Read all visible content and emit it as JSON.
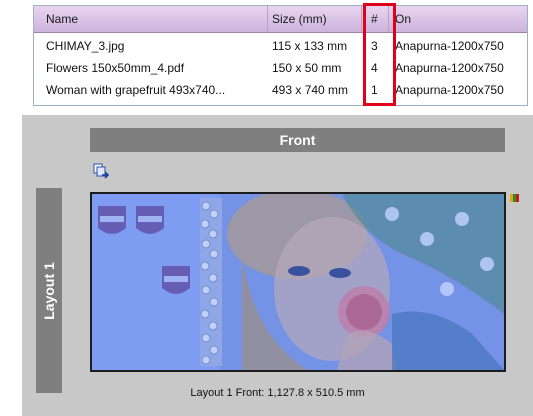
{
  "table": {
    "headers": {
      "name": "Name",
      "size": "Size (mm)",
      "num": "#",
      "on": "On"
    },
    "rows": [
      {
        "name": "CHIMAY_3.jpg",
        "size": "115 x 133 mm",
        "num": "3",
        "on": "Anapurna-1200x750"
      },
      {
        "name": "Flowers 150x50mm_4.pdf",
        "size": "150 x 50 mm",
        "num": "4",
        "on": "Anapurna-1200x750"
      },
      {
        "name": "Woman with grapefruit 493x740...",
        "size": "493 x 740 mm",
        "num": "1",
        "on": "Anapurna-1200x750"
      }
    ]
  },
  "layout": {
    "front_label": "Front",
    "side_label": "Layout 1",
    "caption": "Layout 1 Front: 1,127.8 x 510.5 mm"
  },
  "colors": {
    "header_bg": "#d6c0e4",
    "panel_bg": "#c8c8c8",
    "bar_bg": "#7f7f7f",
    "highlight": "#e0001a",
    "sheet_tint": "#8ba6ee"
  },
  "icons": {
    "tool": "layout-tool-icon",
    "status": "status-color-icon"
  }
}
